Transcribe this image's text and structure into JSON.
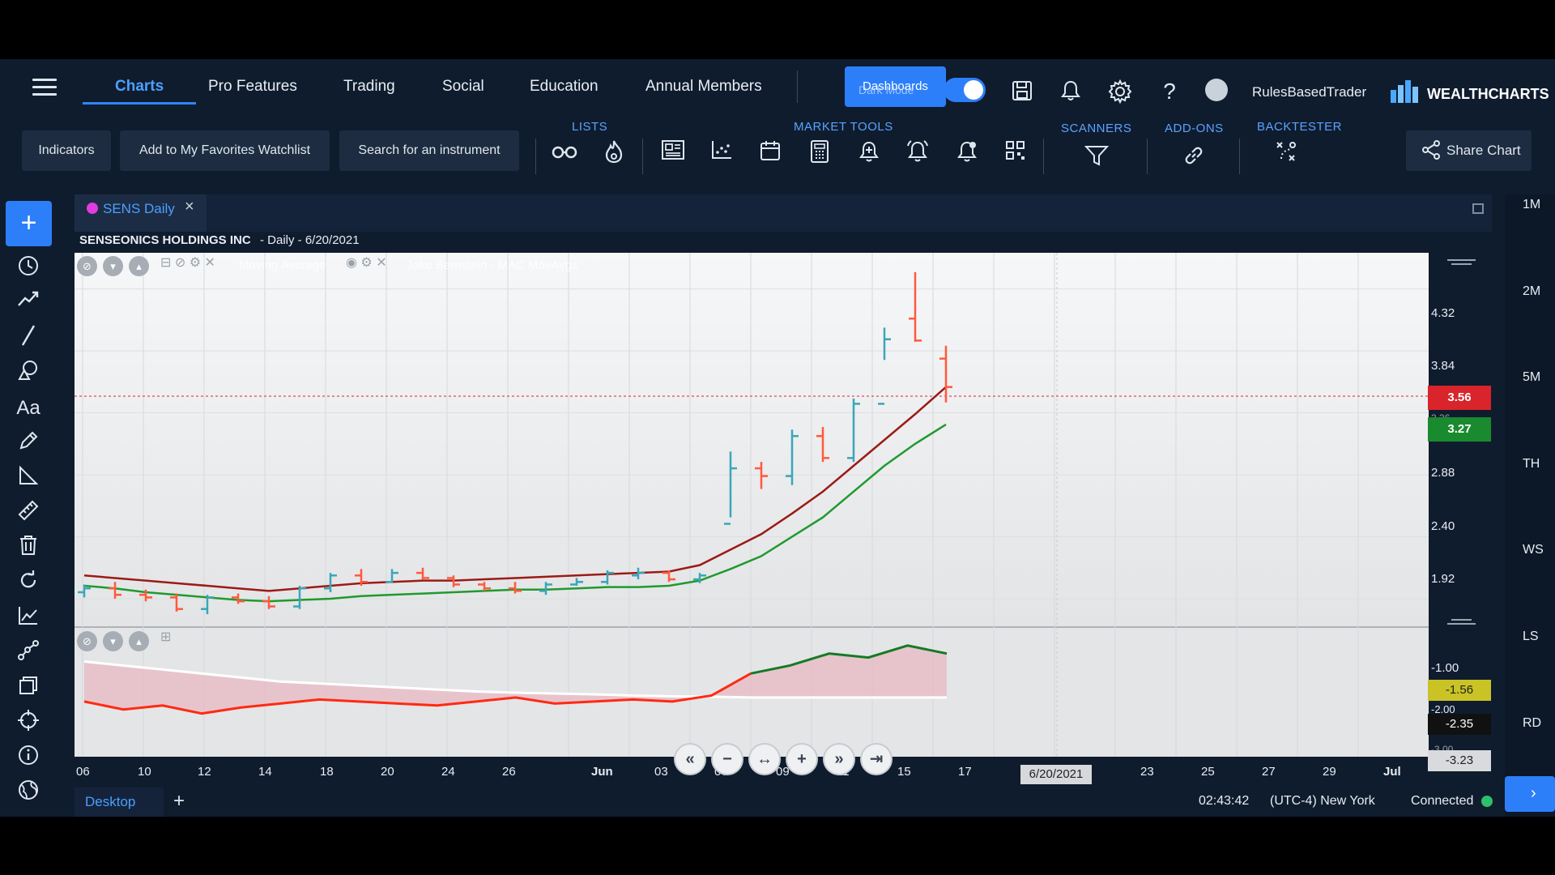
{
  "nav": {
    "tabs": [
      "Charts",
      "Pro Features",
      "Trading",
      "Social",
      "Education",
      "Annual Members"
    ],
    "dashboards_label": "Dashboards",
    "dark_mode_label": "Dark Mode",
    "username": "RulesBasedTrader",
    "brand": "WEALTHCHARTS"
  },
  "toolbar": {
    "indicators_label": "Indicators",
    "favorites_label": "Add to My Favorites Watchlist",
    "search_label": "Search for an instrument",
    "lists_label": "LISTS",
    "market_tools_label": "MARKET TOOLS",
    "scanners_label": "SCANNERS",
    "addons_label": "ADD-ONS",
    "backtester_label": "BACKTESTER",
    "share_label": "Share Chart"
  },
  "chart_tab": {
    "label": "SENS Daily",
    "dot_color": "#e23ce0"
  },
  "chart_header": {
    "symbol_name": "SENSEONICS HOLDINGS INC",
    "period": "- Daily - 6/20/2021"
  },
  "indicators": {
    "moving_average": "Moving Average",
    "mac": "Jake Bernstein - MAC MovAvgs"
  },
  "price_axis": {
    "ticks": [
      "4.32",
      "3.84",
      "3.36",
      "2.88",
      "2.40",
      "1.92"
    ],
    "last_price": "3.56",
    "ma_price": "3.27",
    "lower_ticks": [
      "-1.00",
      "-2.00",
      "-3.00"
    ],
    "lower_box1": "-1.56",
    "lower_box2": "-2.35",
    "lower_box3": "-3.23"
  },
  "date_axis": {
    "labels": [
      "06",
      "10",
      "12",
      "14",
      "18",
      "20",
      "24",
      "26",
      "Jun",
      "03",
      "07",
      "09",
      "11",
      "15",
      "17",
      "21",
      "23",
      "25",
      "27",
      "29",
      "Jul"
    ],
    "cursor_date": "6/20/2021"
  },
  "right_rail": [
    "1M",
    "2M",
    "5M",
    "TH",
    "WS",
    "LS",
    "RD"
  ],
  "status": {
    "desktop_tab": "Desktop",
    "time": "02:43:42",
    "timezone": "(UTC-4) New York",
    "connection": "Connected"
  },
  "colors": {
    "accent": "#2d7ff9",
    "up": "#3aa6b9",
    "down": "#ff5a3c",
    "ma_red": "#9b1b16",
    "ma_green": "#1f9a2e",
    "price_red": "#d8242a",
    "price_green": "#198a2e"
  },
  "chart_data": {
    "type": "ohlc",
    "x": [
      "May 06",
      "May 07",
      "May 10",
      "May 11",
      "May 12",
      "May 13",
      "May 14",
      "May 17",
      "May 18",
      "May 19",
      "May 20",
      "May 21",
      "May 24",
      "May 25",
      "May 26",
      "May 27",
      "May 28",
      "Jun 01",
      "Jun 02",
      "Jun 03",
      "Jun 04",
      "Jun 07",
      "Jun 08",
      "Jun 09",
      "Jun 10",
      "Jun 11",
      "Jun 14",
      "Jun 15",
      "Jun 16"
    ],
    "series": [
      {
        "values": [
          [
            1.97,
            2.03,
            1.93,
            2.0
          ],
          [
            2.0,
            2.05,
            1.92,
            1.95
          ],
          [
            1.95,
            1.99,
            1.9,
            1.93
          ],
          [
            1.93,
            1.96,
            1.82,
            1.84
          ],
          [
            1.84,
            1.95,
            1.8,
            1.93
          ],
          [
            1.93,
            1.96,
            1.88,
            1.9
          ],
          [
            1.9,
            1.94,
            1.84,
            1.86
          ],
          [
            1.86,
            2.02,
            1.84,
            2.0
          ],
          [
            2.0,
            2.12,
            1.97,
            2.1
          ],
          [
            2.1,
            2.15,
            2.02,
            2.05
          ],
          [
            2.05,
            2.15,
            2.04,
            2.12
          ],
          [
            2.12,
            2.16,
            2.07,
            2.08
          ],
          [
            2.08,
            2.1,
            2.01,
            2.03
          ],
          [
            2.03,
            2.05,
            1.98,
            2.0
          ],
          [
            2.0,
            2.05,
            1.96,
            1.98
          ],
          [
            1.98,
            2.05,
            1.95,
            2.03
          ],
          [
            2.03,
            2.08,
            2.02,
            2.05
          ],
          [
            2.05,
            2.14,
            2.03,
            2.12
          ],
          [
            2.1,
            2.16,
            2.07,
            2.12
          ],
          [
            2.12,
            2.14,
            2.05,
            2.07
          ],
          [
            2.07,
            2.12,
            2.04,
            2.1
          ],
          [
            2.5,
            3.06,
            2.55,
            2.93
          ],
          [
            2.93,
            2.98,
            2.77,
            2.87
          ],
          [
            2.87,
            3.23,
            2.8,
            3.18
          ],
          [
            3.18,
            3.25,
            2.98,
            3.01
          ],
          [
            3.01,
            3.47,
            2.98,
            3.43
          ],
          [
            3.43,
            4.02,
            3.77,
            3.93
          ],
          [
            4.09,
            4.45,
            3.91,
            3.92
          ],
          [
            3.78,
            3.88,
            3.44,
            3.56
          ]
        ]
      }
    ],
    "moving_averages": [
      {
        "values": [
          2.1,
          2.08,
          2.06,
          2.04,
          2.02,
          2.0,
          1.98,
          2.0,
          2.02,
          2.04,
          2.05,
          2.06,
          2.06,
          2.07,
          2.08,
          2.09,
          2.1,
          2.11,
          2.12,
          2.13,
          2.18,
          2.3,
          2.42,
          2.58,
          2.75,
          2.95,
          3.15,
          3.35,
          3.56
        ]
      },
      {
        "values": [
          2.02,
          2.0,
          1.97,
          1.95,
          1.93,
          1.91,
          1.9,
          1.91,
          1.92,
          1.94,
          1.95,
          1.96,
          1.97,
          1.98,
          1.99,
          1.99,
          2.0,
          2.01,
          2.01,
          2.02,
          2.06,
          2.15,
          2.25,
          2.4,
          2.55,
          2.75,
          2.95,
          3.12,
          3.27
        ]
      }
    ],
    "lower_panel": {
      "series": [
        {
          "values": [
            -2.0,
            -2.2,
            -2.1,
            -2.3,
            -2.15,
            -2.05,
            -1.95,
            -2.0,
            -2.05,
            -2.1,
            -2.0,
            -1.9,
            -2.05,
            -2.0,
            -1.95,
            -2.0,
            -1.85,
            -1.3,
            -1.1,
            -0.8,
            -0.9,
            -0.6,
            -0.8
          ]
        },
        {
          "values": [
            -1.0,
            -1.1,
            -1.2,
            -1.3,
            -1.4,
            -1.5,
            -1.55,
            -1.6,
            -1.65,
            -1.7,
            -1.75,
            -1.78,
            -1.8,
            -1.82,
            -1.85,
            -1.87,
            -1.88,
            -1.9,
            -1.9,
            -1.9,
            -1.9,
            -1.9,
            -1.9
          ]
        }
      ]
    },
    "ylim": [
      1.7,
      4.6
    ]
  }
}
